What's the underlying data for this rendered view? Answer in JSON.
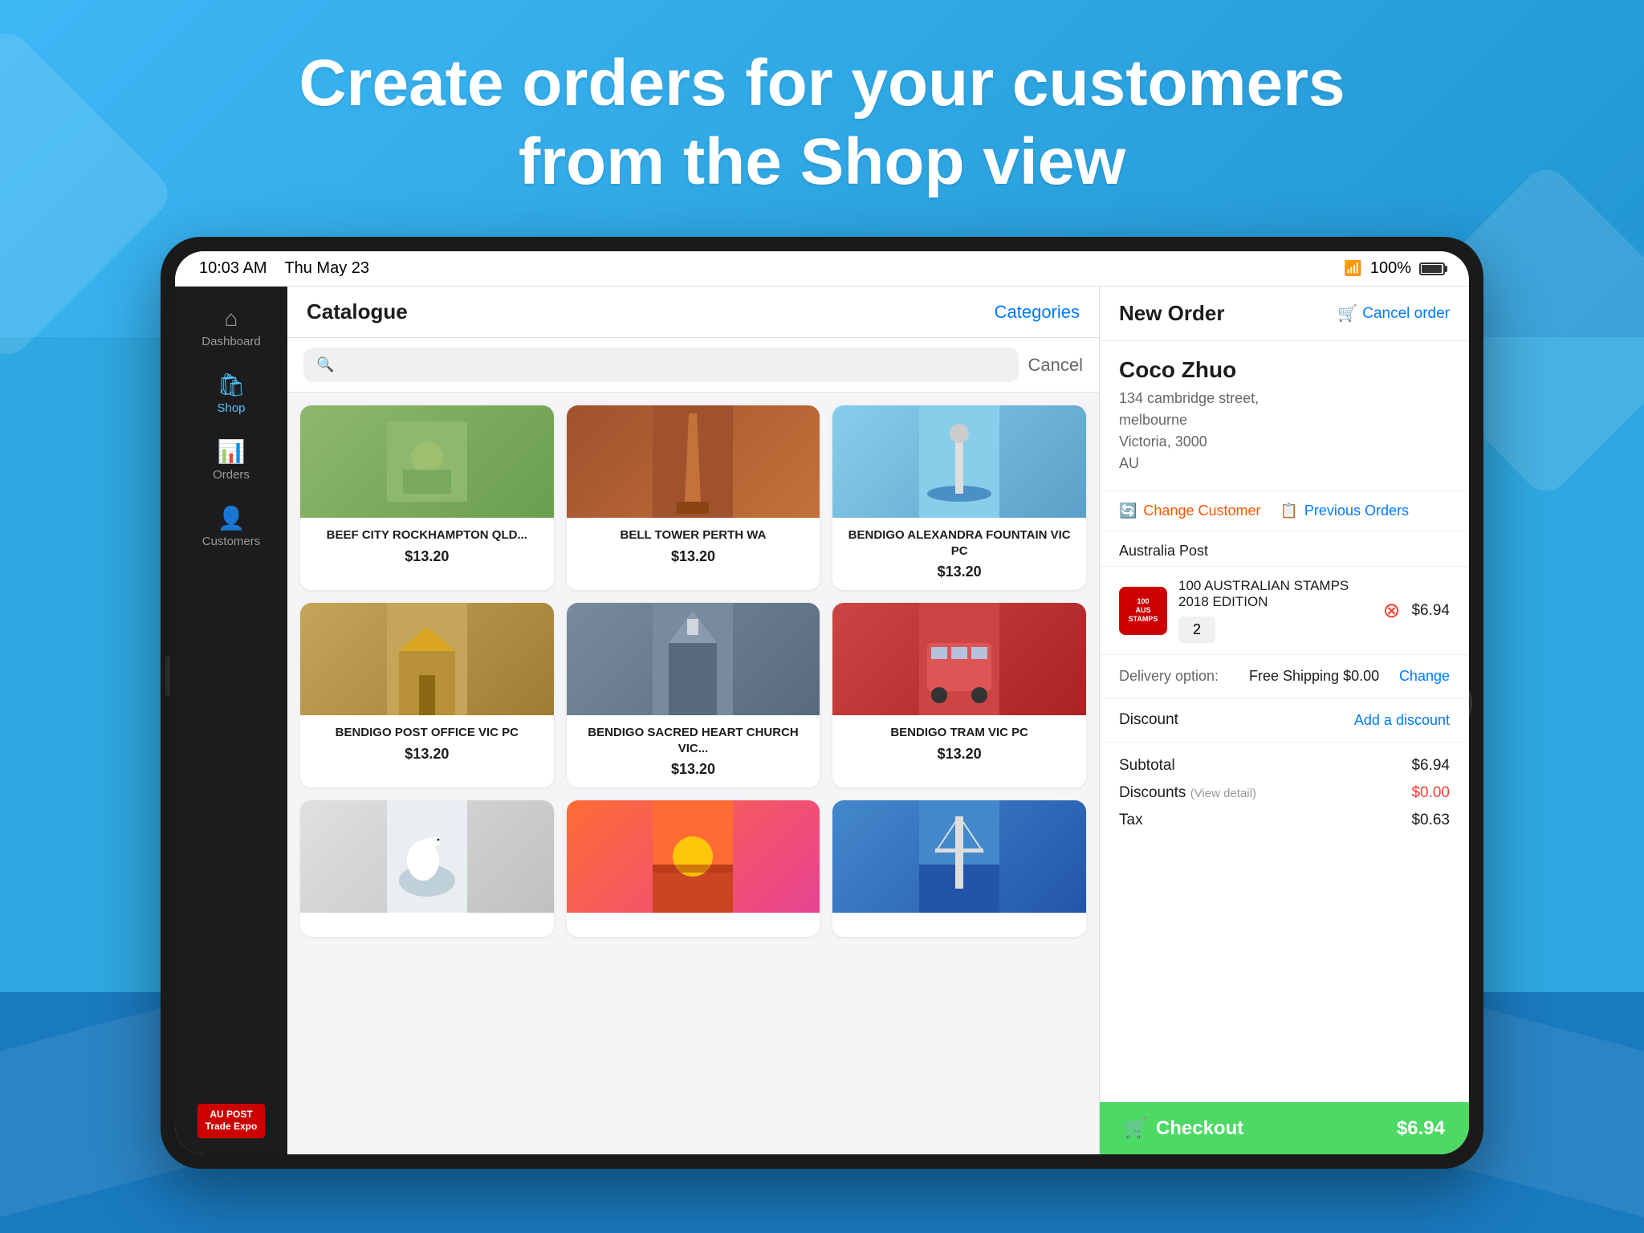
{
  "background": {
    "headline_line1": "Create orders for your customers",
    "headline_line2": "from the Shop view"
  },
  "status_bar": {
    "time": "10:03 AM",
    "date": "Thu May 23",
    "battery_pct": "100%"
  },
  "sidebar": {
    "items": [
      {
        "id": "dashboard",
        "label": "Dashboard",
        "icon": "⌂",
        "active": false
      },
      {
        "id": "shop",
        "label": "Shop",
        "icon": "🛍",
        "active": true
      },
      {
        "id": "orders",
        "label": "Orders",
        "icon": "📊",
        "active": false
      },
      {
        "id": "customers",
        "label": "Customers",
        "icon": "👤",
        "active": false
      }
    ],
    "logo_line1": "AU POST",
    "logo_line2": "Trade Expo"
  },
  "catalogue": {
    "title": "Catalogue",
    "categories_btn": "Categories",
    "search_placeholder": "",
    "cancel_btn": "Cancel",
    "products": [
      {
        "id": 1,
        "name": "BEEF CITY ROCKHAMPTON QLD...",
        "price": "$13.20",
        "img_class": "img-beef"
      },
      {
        "id": 2,
        "name": "BELL TOWER PERTH WA",
        "price": "$13.20",
        "img_class": "img-bell"
      },
      {
        "id": 3,
        "name": "BENDIGO ALEXANDRA FOUNTAIN VIC PC",
        "price": "$13.20",
        "img_class": "img-fountain"
      },
      {
        "id": 4,
        "name": "BENDIGO POST OFFICE VIC PC",
        "price": "$13.20",
        "img_class": "img-postoffice"
      },
      {
        "id": 5,
        "name": "BENDIGO SACRED HEART CHURCH VIC...",
        "price": "$13.20",
        "img_class": "img-sacred"
      },
      {
        "id": 6,
        "name": "BENDIGO TRAM VIC PC",
        "price": "$13.20",
        "img_class": "img-tram"
      },
      {
        "id": 7,
        "name": "",
        "price": "",
        "img_class": "img-swan"
      },
      {
        "id": 8,
        "name": "",
        "price": "",
        "img_class": "img-sunset"
      },
      {
        "id": 9,
        "name": "",
        "price": "",
        "img_class": "img-bridge"
      }
    ]
  },
  "order": {
    "title": "New Order",
    "cancel_label": "Cancel order",
    "customer": {
      "name": "Coco Zhuo",
      "address_line1": "134 cambridge street,",
      "address_line2": "melbourne",
      "address_line3": "Victoria,  3000",
      "address_line4": "AU"
    },
    "change_customer_btn": "Change Customer",
    "previous_orders_btn": "Previous Orders",
    "supplier": "Australia Post",
    "items": [
      {
        "id": 1,
        "name": "100 AUSTRALIAN STAMPS 2018 EDITION",
        "qty": 2,
        "price": "$6.94",
        "thumb_text": "100\nAUSTRALIAN\nSTAMPS"
      }
    ],
    "delivery_label": "Delivery option:",
    "delivery_value": "Free Shipping $0.00",
    "delivery_change": "Change",
    "discount_label": "Discount",
    "add_discount": "Add a discount",
    "subtotal_label": "Subtotal",
    "subtotal_value": "$6.94",
    "discounts_label": "Discounts",
    "discounts_note": "(View detail)",
    "discounts_value": "$0.00",
    "tax_label": "Tax",
    "tax_value": "$0.63",
    "checkout_label": "Checkout",
    "checkout_price": "$6.94"
  }
}
